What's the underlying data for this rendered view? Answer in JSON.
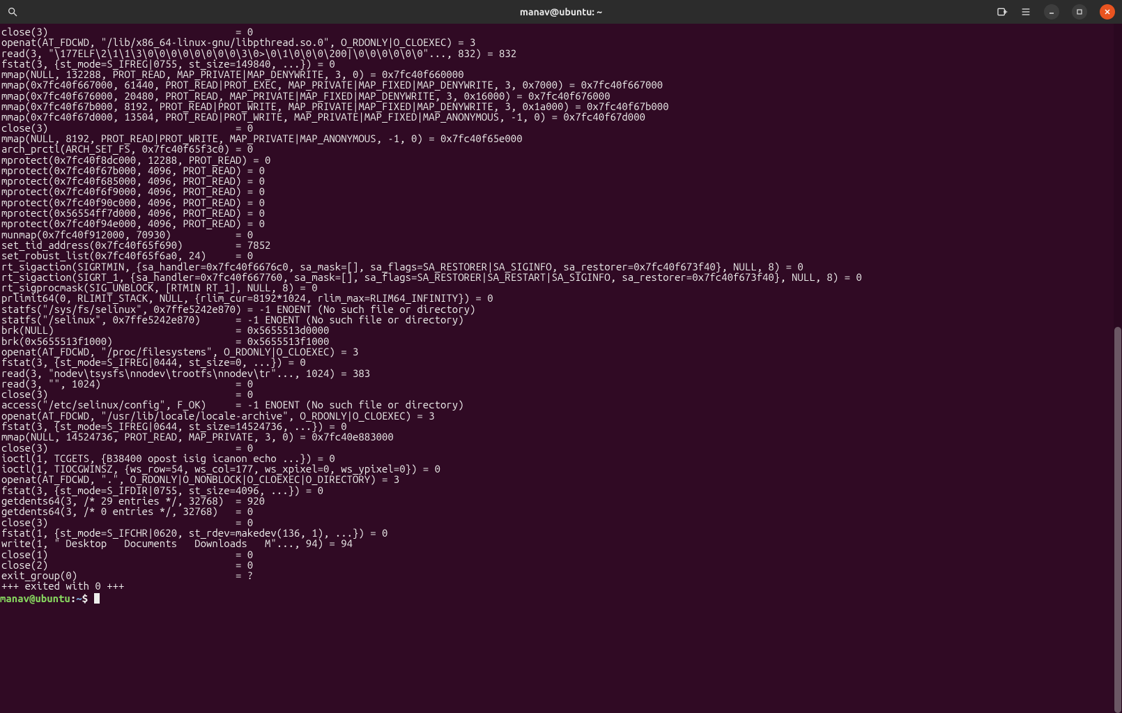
{
  "window": {
    "title": "manav@ubuntu: ~"
  },
  "icons": {
    "search": "search-icon",
    "newtab": "new-tab-icon",
    "menu": "hamburger-menu-icon",
    "minimize": "minimize-icon",
    "maximize": "maximize-icon",
    "close": "close-icon"
  },
  "scrollbar": {
    "thumb_top_pct": 44,
    "thumb_height_pct": 56
  },
  "terminal": {
    "lines": [
      "close(3)                                = 0",
      "openat(AT_FDCWD, \"/lib/x86_64-linux-gnu/libpthread.so.0\", O_RDONLY|O_CLOEXEC) = 3",
      "read(3, \"\\177ELF\\2\\1\\1\\3\\0\\0\\0\\0\\0\\0\\0\\0\\3\\0>\\0\\1\\0\\0\\0\\200|\\0\\0\\0\\0\\0\\0\"..., 832) = 832",
      "fstat(3, {st_mode=S_IFREG|0755, st_size=149840, ...}) = 0",
      "mmap(NULL, 132288, PROT_READ, MAP_PRIVATE|MAP_DENYWRITE, 3, 0) = 0x7fc40f660000",
      "mmap(0x7fc40f667000, 61440, PROT_READ|PROT_EXEC, MAP_PRIVATE|MAP_FIXED|MAP_DENYWRITE, 3, 0x7000) = 0x7fc40f667000",
      "mmap(0x7fc40f676000, 20480, PROT_READ, MAP_PRIVATE|MAP_FIXED|MAP_DENYWRITE, 3, 0x16000) = 0x7fc40f676000",
      "mmap(0x7fc40f67b000, 8192, PROT_READ|PROT_WRITE, MAP_PRIVATE|MAP_FIXED|MAP_DENYWRITE, 3, 0x1a000) = 0x7fc40f67b000",
      "mmap(0x7fc40f67d000, 13504, PROT_READ|PROT_WRITE, MAP_PRIVATE|MAP_FIXED|MAP_ANONYMOUS, -1, 0) = 0x7fc40f67d000",
      "close(3)                                = 0",
      "mmap(NULL, 8192, PROT_READ|PROT_WRITE, MAP_PRIVATE|MAP_ANONYMOUS, -1, 0) = 0x7fc40f65e000",
      "arch_prctl(ARCH_SET_FS, 0x7fc40f65f3c0) = 0",
      "mprotect(0x7fc40f8dc000, 12288, PROT_READ) = 0",
      "mprotect(0x7fc40f67b000, 4096, PROT_READ) = 0",
      "mprotect(0x7fc40f685000, 4096, PROT_READ) = 0",
      "mprotect(0x7fc40f6f9000, 4096, PROT_READ) = 0",
      "mprotect(0x7fc40f90c000, 4096, PROT_READ) = 0",
      "mprotect(0x56554ff7d000, 4096, PROT_READ) = 0",
      "mprotect(0x7fc40f94e000, 4096, PROT_READ) = 0",
      "munmap(0x7fc40f912000, 70930)           = 0",
      "set_tid_address(0x7fc40f65f690)         = 7852",
      "set_robust_list(0x7fc40f65f6a0, 24)     = 0",
      "rt_sigaction(SIGRTMIN, {sa_handler=0x7fc40f6676c0, sa_mask=[], sa_flags=SA_RESTORER|SA_SIGINFO, sa_restorer=0x7fc40f673f40}, NULL, 8) = 0",
      "rt_sigaction(SIGRT_1, {sa_handler=0x7fc40f667760, sa_mask=[], sa_flags=SA_RESTORER|SA_RESTART|SA_SIGINFO, sa_restorer=0x7fc40f673f40}, NULL, 8) = 0",
      "rt_sigprocmask(SIG_UNBLOCK, [RTMIN RT_1], NULL, 8) = 0",
      "prlimit64(0, RLIMIT_STACK, NULL, {rlim_cur=8192*1024, rlim_max=RLIM64_INFINITY}) = 0",
      "statfs(\"/sys/fs/selinux\", 0x7ffe5242e870) = -1 ENOENT (No such file or directory)",
      "statfs(\"/selinux\", 0x7ffe5242e870)      = -1 ENOENT (No such file or directory)",
      "brk(NULL)                               = 0x5655513d0000",
      "brk(0x5655513f1000)                     = 0x5655513f1000",
      "openat(AT_FDCWD, \"/proc/filesystems\", O_RDONLY|O_CLOEXEC) = 3",
      "fstat(3, {st_mode=S_IFREG|0444, st_size=0, ...}) = 0",
      "read(3, \"nodev\\tsysfs\\nnodev\\trootfs\\nnodev\\tr\"..., 1024) = 383",
      "read(3, \"\", 1024)                       = 0",
      "close(3)                                = 0",
      "access(\"/etc/selinux/config\", F_OK)     = -1 ENOENT (No such file or directory)",
      "openat(AT_FDCWD, \"/usr/lib/locale/locale-archive\", O_RDONLY|O_CLOEXEC) = 3",
      "fstat(3, {st_mode=S_IFREG|0644, st_size=14524736, ...}) = 0",
      "mmap(NULL, 14524736, PROT_READ, MAP_PRIVATE, 3, 0) = 0x7fc40e883000",
      "close(3)                                = 0",
      "ioctl(1, TCGETS, {B38400 opost isig icanon echo ...}) = 0",
      "ioctl(1, TIOCGWINSZ, {ws_row=54, ws_col=177, ws_xpixel=0, ws_ypixel=0}) = 0",
      "openat(AT_FDCWD, \".\", O_RDONLY|O_NONBLOCK|O_CLOEXEC|O_DIRECTORY) = 3",
      "fstat(3, {st_mode=S_IFDIR|0755, st_size=4096, ...}) = 0",
      "getdents64(3, /* 29 entries */, 32768)  = 920",
      "getdents64(3, /* 0 entries */, 32768)   = 0",
      "close(3)                                = 0",
      "fstat(1, {st_mode=S_IFCHR|0620, st_rdev=makedev(136, 1), ...}) = 0",
      "write(1, \" Desktop   Documents   Downloads   M\"..., 94) = 94",
      "close(1)                                = 0",
      "close(2)                                = 0",
      "exit_group(0)                           = ?",
      "+++ exited with 0 +++"
    ],
    "prompt": {
      "user_host": "manav@ubuntu",
      "colon": ":",
      "path": "~",
      "dollar": "$ "
    }
  }
}
